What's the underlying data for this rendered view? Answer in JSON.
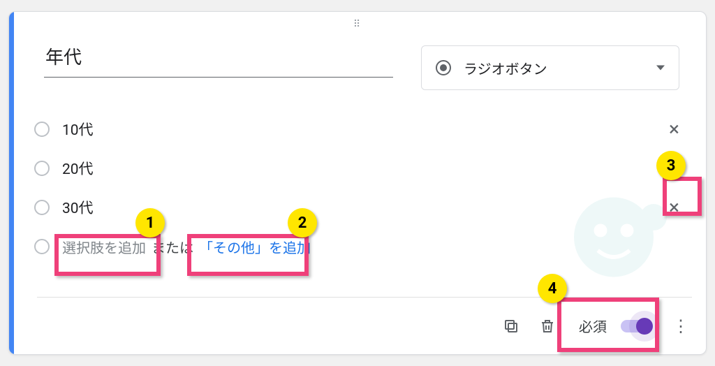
{
  "question": {
    "title": "年代",
    "type_label": "ラジオボタン",
    "options": [
      {
        "label": "10代"
      },
      {
        "label": "20代"
      },
      {
        "label": "30代"
      }
    ],
    "add_option_placeholder": "選択肢を追加",
    "or_text": "または",
    "add_other_label": "「その他」を追加",
    "required_label": "必須",
    "required_on": true
  },
  "annotations": {
    "b1": "1",
    "b2": "2",
    "b3": "3",
    "b4": "4"
  }
}
